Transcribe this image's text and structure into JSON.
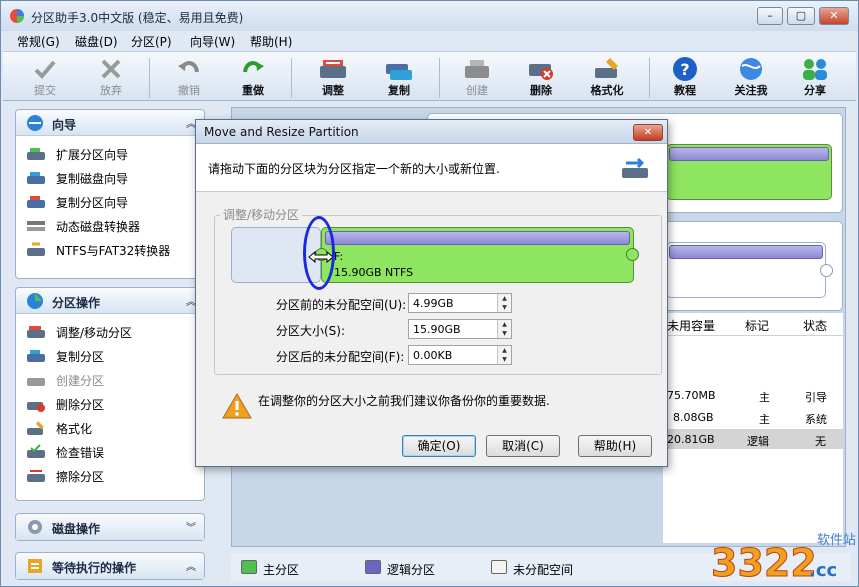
{
  "window": {
    "title": "分区助手3.0中文版 (稳定、易用且免费)",
    "min": "▭",
    "max": "▢",
    "close": "✕"
  },
  "menu": [
    "常规(G)",
    "磁盘(D)",
    "分区(P)",
    "向导(W)",
    "帮助(H)"
  ],
  "toolbar": [
    {
      "label": "提交",
      "icon": "commit-icon",
      "disabled": true
    },
    {
      "label": "放弃",
      "icon": "discard-icon",
      "disabled": true
    },
    {
      "label": "撤销",
      "icon": "undo-icon",
      "disabled": true
    },
    {
      "label": "重做",
      "icon": "redo-icon",
      "disabled": false
    },
    {
      "label": "调整",
      "icon": "resize-icon",
      "disabled": false
    },
    {
      "label": "复制",
      "icon": "copy-icon",
      "disabled": false
    },
    {
      "label": "创建",
      "icon": "create-icon",
      "disabled": true
    },
    {
      "label": "删除",
      "icon": "delete-icon",
      "disabled": false
    },
    {
      "label": "格式化",
      "icon": "format-icon",
      "disabled": false
    },
    {
      "label": "教程",
      "icon": "help-icon",
      "disabled": false
    },
    {
      "label": "关注我",
      "icon": "follow-icon",
      "disabled": false
    },
    {
      "label": "分享",
      "icon": "share-icon",
      "disabled": false
    }
  ],
  "wizard_panel": {
    "title": "向导",
    "items": [
      "扩展分区向导",
      "复制磁盘向导",
      "复制分区向导",
      "动态磁盘转换器",
      "NTFS与FAT32转换器"
    ]
  },
  "partition_panel": {
    "title": "分区操作",
    "items": [
      "调整/移动分区",
      "复制分区",
      "创建分区",
      "删除分区",
      "格式化",
      "检查错误",
      "擦除分区"
    ]
  },
  "disk_panel": {
    "title": "磁盘操作"
  },
  "pending_panel": {
    "title": "等待执行的操作"
  },
  "table": {
    "headers": [
      "未用容量",
      "标记",
      "状态"
    ],
    "rows": [
      [
        "75.70MB",
        "主",
        "引导"
      ],
      [
        "8.08GB",
        "主",
        "系统"
      ],
      [
        "20.81GB",
        "逻辑",
        "无"
      ]
    ]
  },
  "legend": [
    "主分区",
    "逻辑分区",
    "未分配空间"
  ],
  "dialog": {
    "title": "Move and Resize Partition",
    "close": "✕",
    "instruction": "请拖动下面的分区块为分区指定一个新的大小或新位置.",
    "group_label": "调整/移动分区",
    "partition_line1": "F:",
    "partition_line2": "15.90GB NTFS",
    "fields": [
      {
        "label": "分区前的未分配空间(U):",
        "value": "4.99GB"
      },
      {
        "label": "分区大小(S):",
        "value": "15.90GB"
      },
      {
        "label": "分区后的未分配空间(F):",
        "value": "0.00KB"
      }
    ],
    "warning": "在调整你的分区大小之前我们建议你备份你的重要数据.",
    "ok": "确定(O)",
    "cancel": "取消(C)",
    "help": "帮助(H)"
  },
  "watermark": {
    "site": "软件站",
    "brand": "3322",
    "tld": ".cc"
  },
  "colors": {
    "primary": "#8ee55f",
    "logical": "#8c88d6",
    "accent": "#1a2adf"
  }
}
